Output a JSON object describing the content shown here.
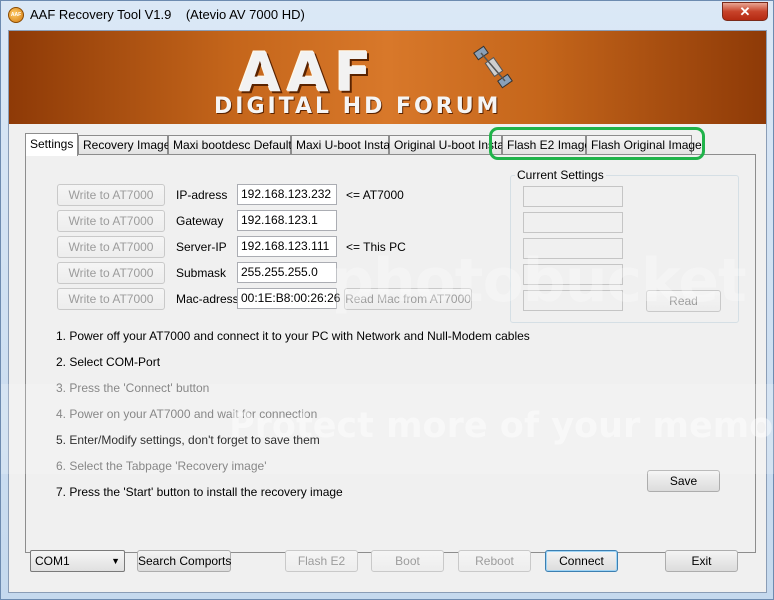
{
  "window": {
    "title": "AAF Recovery Tool V1.9    (Atevio AV 7000 HD)",
    "icon_text": "AAF",
    "close_glyph": "✕"
  },
  "banner": {
    "logo": "AAF",
    "subtitle": "DIGITAL HD FORUM"
  },
  "tabs": [
    {
      "label": "Settings",
      "active": true
    },
    {
      "label": "Recovery Image",
      "active": false
    },
    {
      "label": "Maxi bootdesc Defaults",
      "active": false
    },
    {
      "label": "Maxi U-boot Install",
      "active": false
    },
    {
      "label": "Original U-boot Install",
      "active": false
    },
    {
      "label": "Flash E2 Image",
      "active": false
    },
    {
      "label": "Flash Original Image",
      "active": false
    }
  ],
  "settings": {
    "write_button_label": "Write to AT7000",
    "fields": [
      {
        "label": "IP-adress",
        "value": "192.168.123.232",
        "note": "<= AT7000"
      },
      {
        "label": "Gateway",
        "value": "192.168.123.1",
        "note": ""
      },
      {
        "label": "Server-IP",
        "value": "192.168.123.111",
        "note": "<= This PC"
      },
      {
        "label": "Submask",
        "value": "255.255.255.0",
        "note": ""
      },
      {
        "label": "Mac-adress",
        "value": "00:1E:B8:00:26:26",
        "note": ""
      }
    ],
    "read_mac_button": "Read Mac from AT7000",
    "current_settings_title": "Current Settings",
    "read_button": "Read",
    "save_button": "Save",
    "steps": [
      "1. Power off your AT7000 and connect it to your PC with Network and Null-Modem cables",
      "2. Select COM-Port",
      "3. Press the 'Connect' button",
      "4. Power on your AT7000 and wait for connection",
      "5. Enter/Modify settings, don't forget to save them",
      "6. Select the Tabpage 'Recovery image'",
      "7. Press the 'Start' button to install the recovery image"
    ]
  },
  "bottom": {
    "com_port": "COM1",
    "search_comports": "Search Comports",
    "flash_e2": "Flash E2",
    "boot": "Boot",
    "reboot": "Reboot",
    "connect": "Connect",
    "exit": "Exit"
  },
  "watermark": {
    "line1": "photobucket",
    "line2": "Protect more of your memories for less!"
  },
  "colors": {
    "highlight": "#20b34a",
    "banner": "#c5661b",
    "close": "#c7432a"
  }
}
